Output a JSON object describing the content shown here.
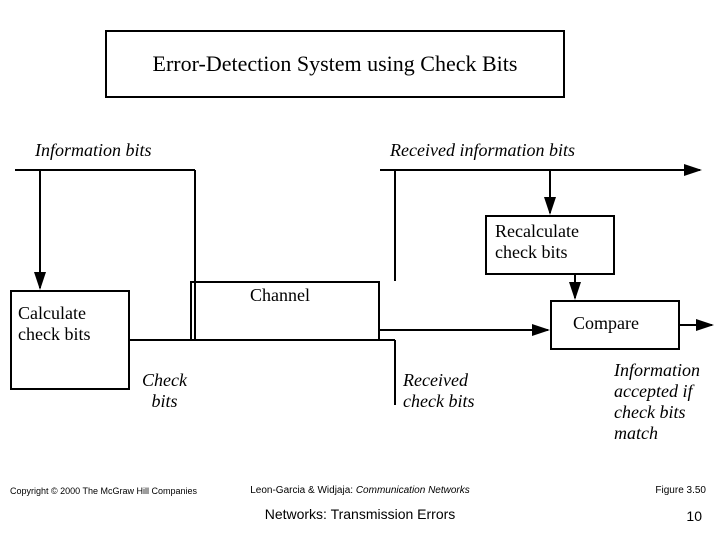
{
  "title": "Error-Detection System using Check Bits",
  "labels": {
    "info_bits": "Information bits",
    "received_info": "Received information bits",
    "recalc": "Recalculate\ncheck bits",
    "channel": "Channel",
    "calc": "Calculate\ncheck bits",
    "compare": "Compare",
    "check_bits": "Check\nbits",
    "received_check": "Received\ncheck bits",
    "accepted": "Information\naccepted if\ncheck bits\nmatch"
  },
  "footer": {
    "copyright": "Copyright © 2000 The McGraw Hill Companies",
    "citation_authors": "Leon-Garcia & Widjaja:",
    "citation_title": "Communication Networks",
    "figure": "Figure 3.50",
    "subtitle": "Networks: Transmission Errors",
    "page": "10"
  }
}
